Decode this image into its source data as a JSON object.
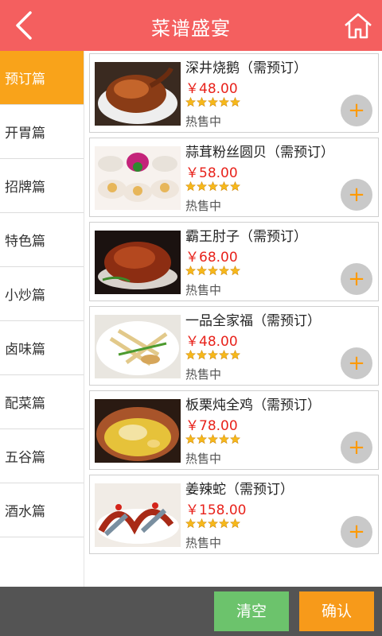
{
  "header": {
    "title": "菜谱盛宴",
    "back_icon": "chevron-left-icon",
    "home_icon": "home-icon",
    "color": "#f45f5f"
  },
  "sidebar": {
    "active_index": 0,
    "active_color": "#f9a31a",
    "items": [
      {
        "label": "预订篇"
      },
      {
        "label": "开胃篇"
      },
      {
        "label": "招牌篇"
      },
      {
        "label": "特色篇"
      },
      {
        "label": "小炒篇"
      },
      {
        "label": "卤味篇"
      },
      {
        "label": "配菜篇"
      },
      {
        "label": "五谷篇"
      },
      {
        "label": "酒水篇"
      }
    ]
  },
  "dishes": [
    {
      "name": "深井烧鹅（需预订）",
      "price": "￥48.00",
      "rating": 5,
      "status": "热售中",
      "photo_icon": "roast-goose-photo"
    },
    {
      "name": "蒜茸粉丝圆贝（需预订）",
      "price": "￥58.00",
      "rating": 5,
      "status": "热售中",
      "photo_icon": "scallops-photo"
    },
    {
      "name": "霸王肘子（需预订）",
      "price": "￥68.00",
      "rating": 5,
      "status": "热售中",
      "photo_icon": "pork-knuckle-photo"
    },
    {
      "name": "一品全家福（需预订）",
      "price": "￥48.00",
      "rating": 5,
      "status": "热售中",
      "photo_icon": "family-stew-photo"
    },
    {
      "name": "板栗炖全鸡（需预订）",
      "price": "￥78.00",
      "rating": 5,
      "status": "热售中",
      "photo_icon": "chestnut-chicken-photo"
    },
    {
      "name": "姜辣蛇（需预订）",
      "price": "￥158.00",
      "rating": 5,
      "status": "热售中",
      "photo_icon": "ginger-snake-photo"
    }
  ],
  "add_icon": "plus-icon",
  "add_label": "+",
  "footer": {
    "clear_label": "清空",
    "confirm_label": "确认",
    "clear_color": "#6cc36c",
    "confirm_color": "#f79a1a"
  }
}
